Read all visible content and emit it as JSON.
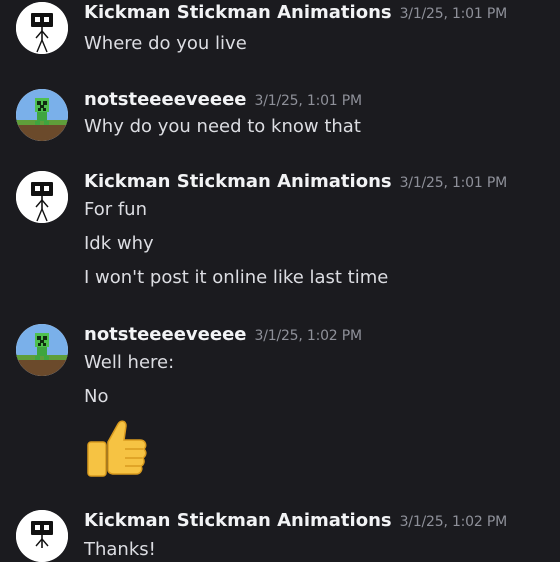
{
  "messages": [
    {
      "author": "Kickman Stickman Animations",
      "timestamp": "3/1/25, 1:01 PM",
      "avatar": "stickman-avatar",
      "lines": [
        "Where do you live"
      ]
    },
    {
      "author": "notsteeeeveeee",
      "timestamp": "3/1/25, 1:01 PM",
      "avatar": "creeper-avatar",
      "lines": [
        "Why do you need to know that"
      ]
    },
    {
      "author": "Kickman Stickman Animations",
      "timestamp": "3/1/25, 1:01 PM",
      "avatar": "stickman-avatar",
      "lines": [
        "For fun",
        "Idk why",
        "I won't post it online like last time"
      ]
    },
    {
      "author": "notsteeeeveeee",
      "timestamp": "3/1/25, 1:02 PM",
      "avatar": "creeper-avatar",
      "lines": [
        "Well here:",
        "No"
      ],
      "emoji": "thumbs-up-emoji"
    },
    {
      "author": "Kickman Stickman Animations",
      "timestamp": "3/1/25, 1:02 PM",
      "avatar": "stickman-avatar",
      "lines": [
        "Thanks!"
      ]
    }
  ],
  "colors": {
    "background": "#1b1b1f",
    "author": "#f2f3f5",
    "timestamp": "#8e9099",
    "message_text": "#dcdde2"
  }
}
